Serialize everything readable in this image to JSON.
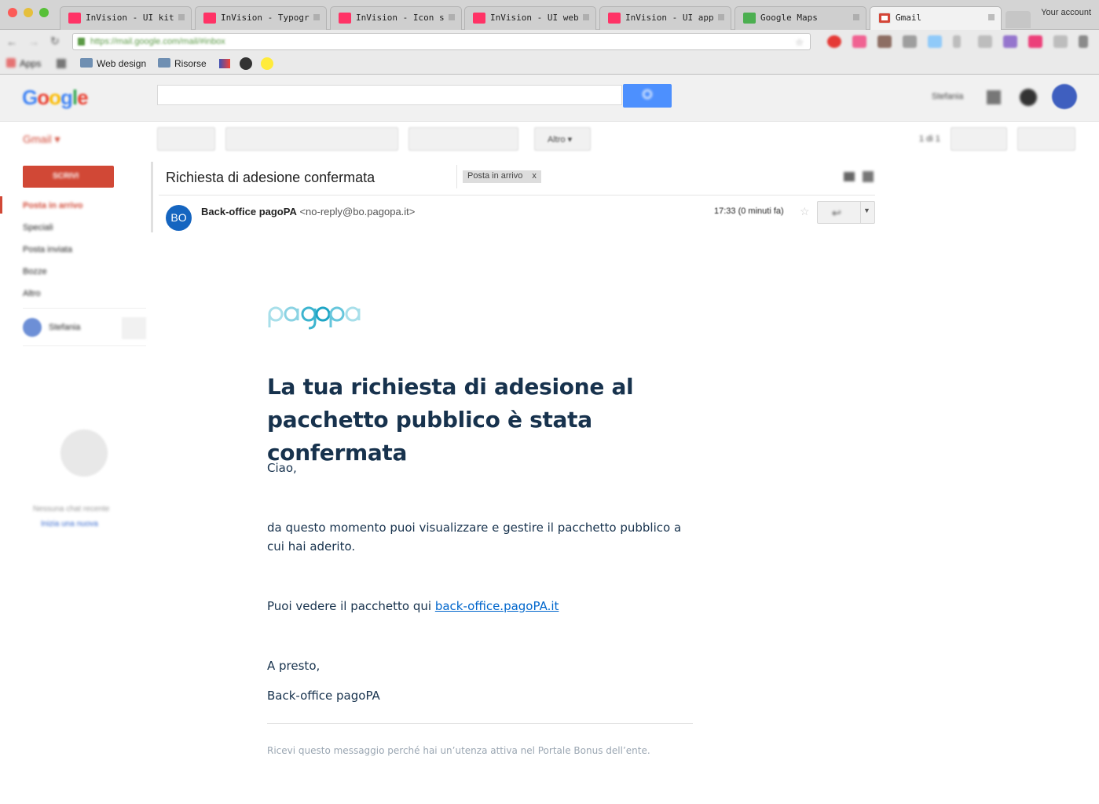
{
  "browser": {
    "tabs": [
      {
        "label": "InVision - UI kit"
      },
      {
        "label": "InVision - Typogr"
      },
      {
        "label": "InVision - Icon s"
      },
      {
        "label": "InVision - UI web"
      },
      {
        "label": "InVision - UI app"
      },
      {
        "label": "Google Maps"
      },
      {
        "label": "Gmail"
      }
    ],
    "account_label": "Your account",
    "url": "https://mail.google.com/mail/#inbox",
    "bookmarks": [
      {
        "label": "Apps"
      },
      {
        "label": "Web design"
      },
      {
        "label": "Risorse"
      }
    ]
  },
  "gmail": {
    "logo": "Google",
    "product_label": "Gmail",
    "user_name": "Stefania",
    "more_button": "Altro",
    "pagination": "1 di 1",
    "compose_label": "SCRIVI",
    "nav": [
      "Posta in arrivo",
      "Speciali",
      "Posta inviata",
      "Bozze",
      "Altro"
    ],
    "chat_user": "Stefania",
    "chat_empty": "Nessuna chat recente",
    "chat_start": "Inizia una nuova"
  },
  "message": {
    "subject": "Richiesta di adesione confermata",
    "label": "Posta in arrivo",
    "label_close": "x",
    "avatar_initials": "BO",
    "sender_name": "Back-office pagoPA",
    "sender_email": "<no-reply@bo.pagopa.it>",
    "time": "17:33 (0 minuti fa)"
  },
  "email": {
    "logo": "pagopa",
    "heading": "La tua richiesta di adesione al pacchetto pubblico è stata confermata",
    "greeting": "Ciao,",
    "paragraph": "da questo momento puoi visualizzare e gestire il pacchetto pubblico a cui hai aderito.",
    "link_intro": "Puoi vedere il pacchetto qui ",
    "link_text": "back-office.pagoPA.it",
    "closing": "A presto,",
    "signature": "Back-office pagoPA",
    "footer": "Ricevi questo messaggio perché hai un’utenza attiva nel Portale Bonus dell’ente."
  },
  "colors": {
    "accent": "#4d90fe",
    "compose": "#d14836",
    "email_text": "#17324d",
    "link": "#0066cc",
    "pagopa": "#5fc3d9"
  }
}
